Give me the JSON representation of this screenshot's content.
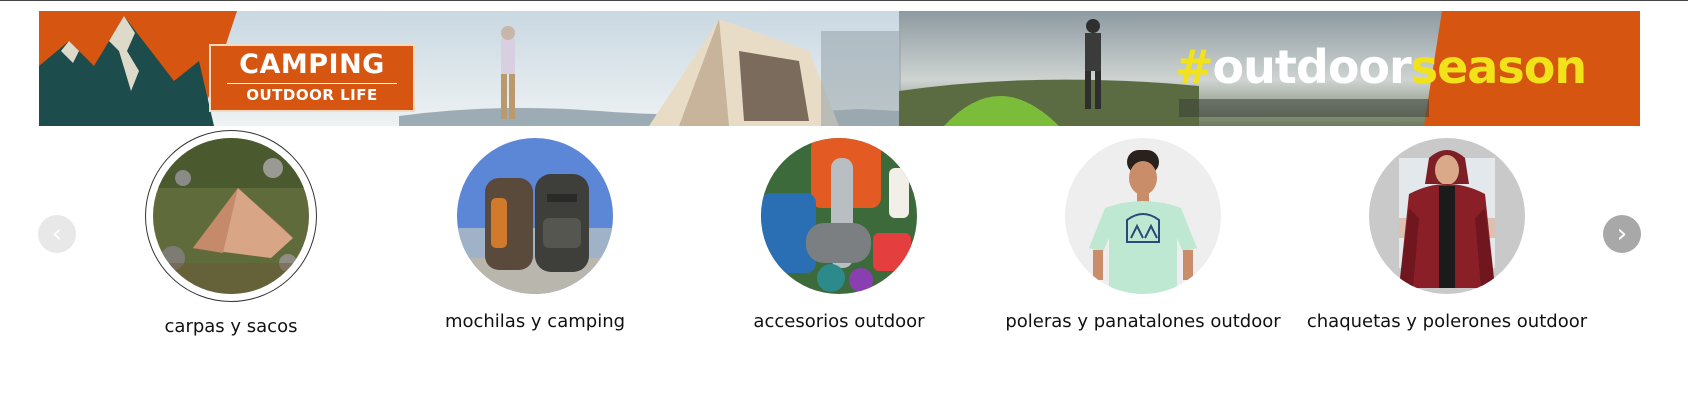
{
  "banner": {
    "brand_line1": "CAMPING",
    "brand_line2": "OUTDOOR LIFE",
    "hashtag_symbol": "#",
    "hashtag_word": "outdoor",
    "hashtag_season": "season",
    "colors": {
      "orange": "#d65511",
      "hashtag_yellow": "#f1e21a",
      "mountain_teal": "#1d4c4c"
    }
  },
  "carousel": {
    "prev_icon": "chevron-left-icon",
    "next_icon": "chevron-right-icon",
    "prev_symbol": "‹",
    "next_symbol": "›",
    "categories": [
      {
        "label": "carpas y sacos",
        "icon": "tent-photo",
        "active": true
      },
      {
        "label": "mochilas y camping",
        "icon": "backpacks-photo",
        "active": false
      },
      {
        "label": "accesorios outdoor",
        "icon": "accessories-photo",
        "active": false
      },
      {
        "label": "poleras y panatalones outdoor",
        "icon": "tshirt-photo",
        "active": false
      },
      {
        "label": "chaquetas y polerones outdoor",
        "icon": "jacket-photo",
        "active": false
      }
    ]
  }
}
